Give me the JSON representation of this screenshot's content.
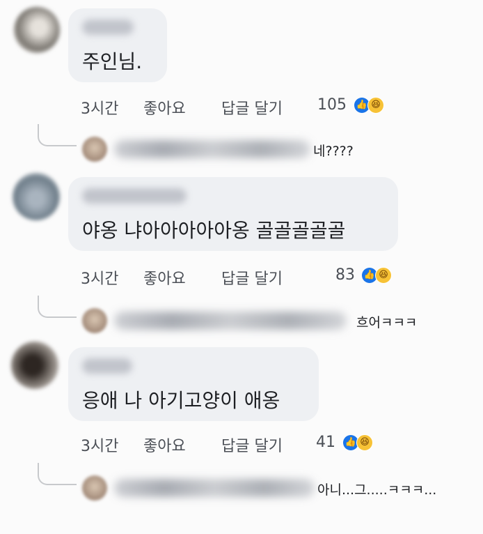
{
  "comments": [
    {
      "text": "주인님.",
      "time": "3시간",
      "like_label": "좋아요",
      "reply_label": "답글 달기",
      "reaction_count": "105",
      "reply_snippet": "네????"
    },
    {
      "text": "야옹 냐아아아아아옹 골골골골골",
      "time": "3시간",
      "like_label": "좋아요",
      "reply_label": "답글 달기",
      "reaction_count": "83",
      "reply_snippet": "흐어ㅋㅋㅋ"
    },
    {
      "text": "응애 나 아기고양이 애옹",
      "time": "3시간",
      "like_label": "좋아요",
      "reply_label": "답글 달기",
      "reaction_count": "41",
      "reply_snippet": "아니...그.....ㅋㅋㅋ..."
    }
  ],
  "icons": {
    "like": "like-icon",
    "haha": "haha-icon"
  },
  "colors": {
    "background": "#fbfbfb",
    "bubble": "#eef0f3",
    "like_blue": "#1a74e8",
    "haha_yellow": "#f7c236",
    "meta_text": "#4b4f56"
  }
}
